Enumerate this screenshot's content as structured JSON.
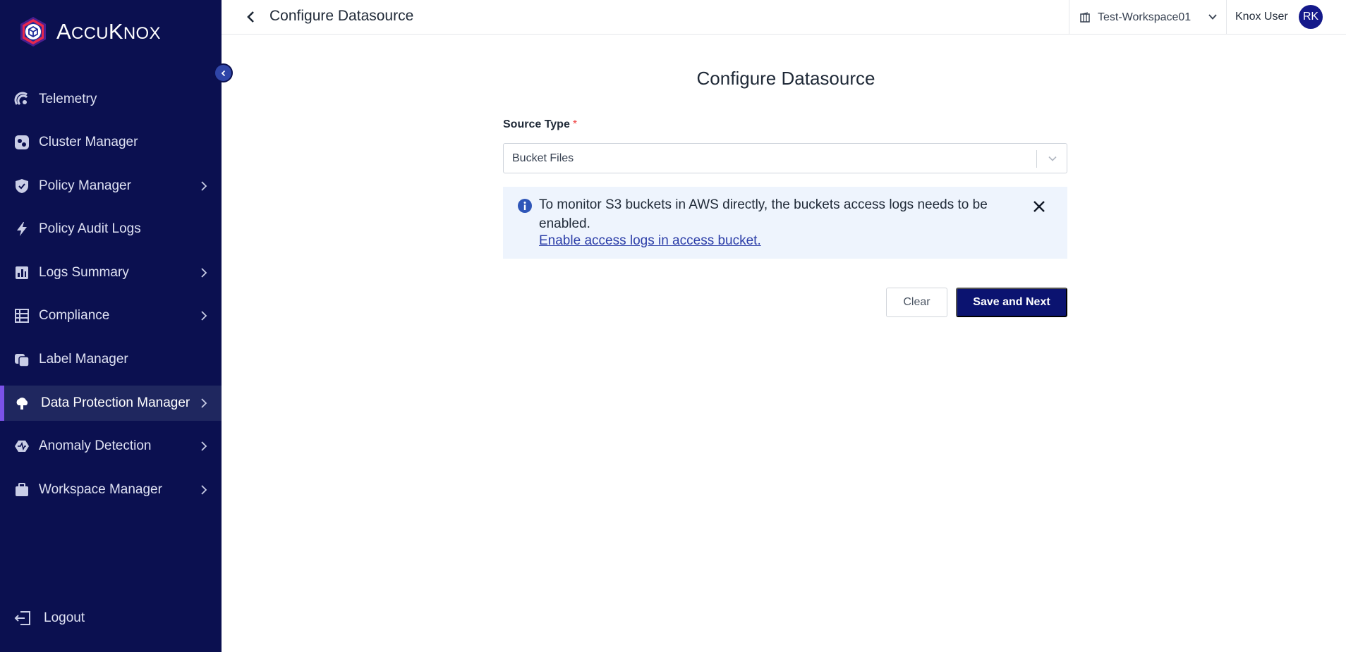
{
  "brand": {
    "name_first": "A",
    "name_rest": "CCU",
    "name_k": "K",
    "name_end": "NOX"
  },
  "sidebar": {
    "items": [
      {
        "label": "Telemetry",
        "icon": "telemetry-icon",
        "has_children": false
      },
      {
        "label": "Cluster Manager",
        "icon": "cluster-icon",
        "has_children": false
      },
      {
        "label": "Policy Manager",
        "icon": "shield-icon",
        "has_children": true
      },
      {
        "label": "Policy Audit Logs",
        "icon": "bolt-icon",
        "has_children": false
      },
      {
        "label": "Logs Summary",
        "icon": "bar-chart-icon",
        "has_children": true
      },
      {
        "label": "Compliance",
        "icon": "table-icon",
        "has_children": true
      },
      {
        "label": "Label Manager",
        "icon": "label-icon",
        "has_children": false
      },
      {
        "label": "Data Protection Manager",
        "icon": "data-protection-icon",
        "has_children": true,
        "active": true
      },
      {
        "label": "Anomaly Detection",
        "icon": "anomaly-icon",
        "has_children": true
      },
      {
        "label": "Workspace Manager",
        "icon": "briefcase-icon",
        "has_children": true
      }
    ],
    "logout_label": "Logout"
  },
  "header": {
    "title": "Configure Datasource",
    "workspace": "Test-Workspace01",
    "user_name": "Knox User",
    "avatar_initials": "RK"
  },
  "form": {
    "title": "Configure Datasource",
    "source_type_label": "Source Type",
    "required_mark": "*",
    "source_type_value": "Bucket Files",
    "alert_message": "To monitor S3 buckets in AWS directly, the buckets access logs needs to be enabled.",
    "alert_link": "Enable access logs in access bucket.",
    "clear_label": "Clear",
    "save_label": "Save and Next"
  },
  "colors": {
    "sidebar_bg": "#0b1050",
    "active_accent": "#7b52e8",
    "primary_button": "#0b1370",
    "link": "#2c3ea8"
  }
}
